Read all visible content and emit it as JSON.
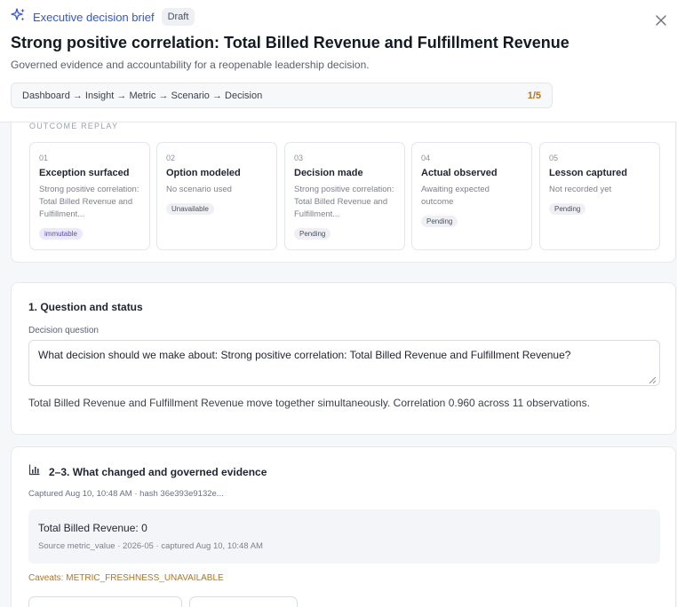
{
  "header": {
    "brand_label": "Executive decision brief",
    "status_badge": "Draft",
    "title": "Strong positive correlation: Total Billed Revenue and Fulfillment Revenue",
    "subtitle": "Governed evidence and accountability for a reopenable leadership decision.",
    "breadcrumb": "Dashboard → Insight → Metric → Scenario → Decision",
    "step": "1/5"
  },
  "replay": {
    "heading": "OUTCOME REPLAY",
    "stages": [
      {
        "num": "01",
        "title": "Exception surfaced",
        "desc": "Strong positive correlation: Total Billed Revenue and Fulfillment...",
        "pill": "immutable"
      },
      {
        "num": "02",
        "title": "Option modeled",
        "desc": "No scenario used",
        "pill": "Unavailable"
      },
      {
        "num": "03",
        "title": "Decision made",
        "desc": "Strong positive correlation: Total Billed Revenue and Fulfillment...",
        "pill": "Pending"
      },
      {
        "num": "04",
        "title": "Actual observed",
        "desc": "Awaiting expected outcome",
        "pill": "Pending"
      },
      {
        "num": "05",
        "title": "Lesson captured",
        "desc": "Not recorded yet",
        "pill": "Pending"
      }
    ]
  },
  "question": {
    "title": "1. Question and status",
    "field_label": "Decision question",
    "value": "What decision should we make about: Strong positive correlation: Total Billed Revenue and Fulfillment Revenue?",
    "explanation": "Total Billed Revenue and Fulfillment Revenue move together simultaneously. Correlation 0.960 across 11 observations."
  },
  "evidence": {
    "title": "2–3. What changed and governed evidence",
    "captured": "Captured Aug 10, 10:48 AM · hash 36e393e9132e...",
    "metric_value": "Total Billed Revenue: 0",
    "metric_source": "Source metric_value · 2026-05 · captured Aug 10, 10:48 AM",
    "caveats": "Caveats: METRIC_FRESHNESS_UNAVAILABLE"
  },
  "colors": {
    "accent": "#3158d6",
    "warning": "#b8741a",
    "immutable": "#5b4cc7"
  },
  "icons": {
    "brand": "sparkle-icon",
    "close": "close-icon",
    "evidence": "bar-chart-icon"
  }
}
